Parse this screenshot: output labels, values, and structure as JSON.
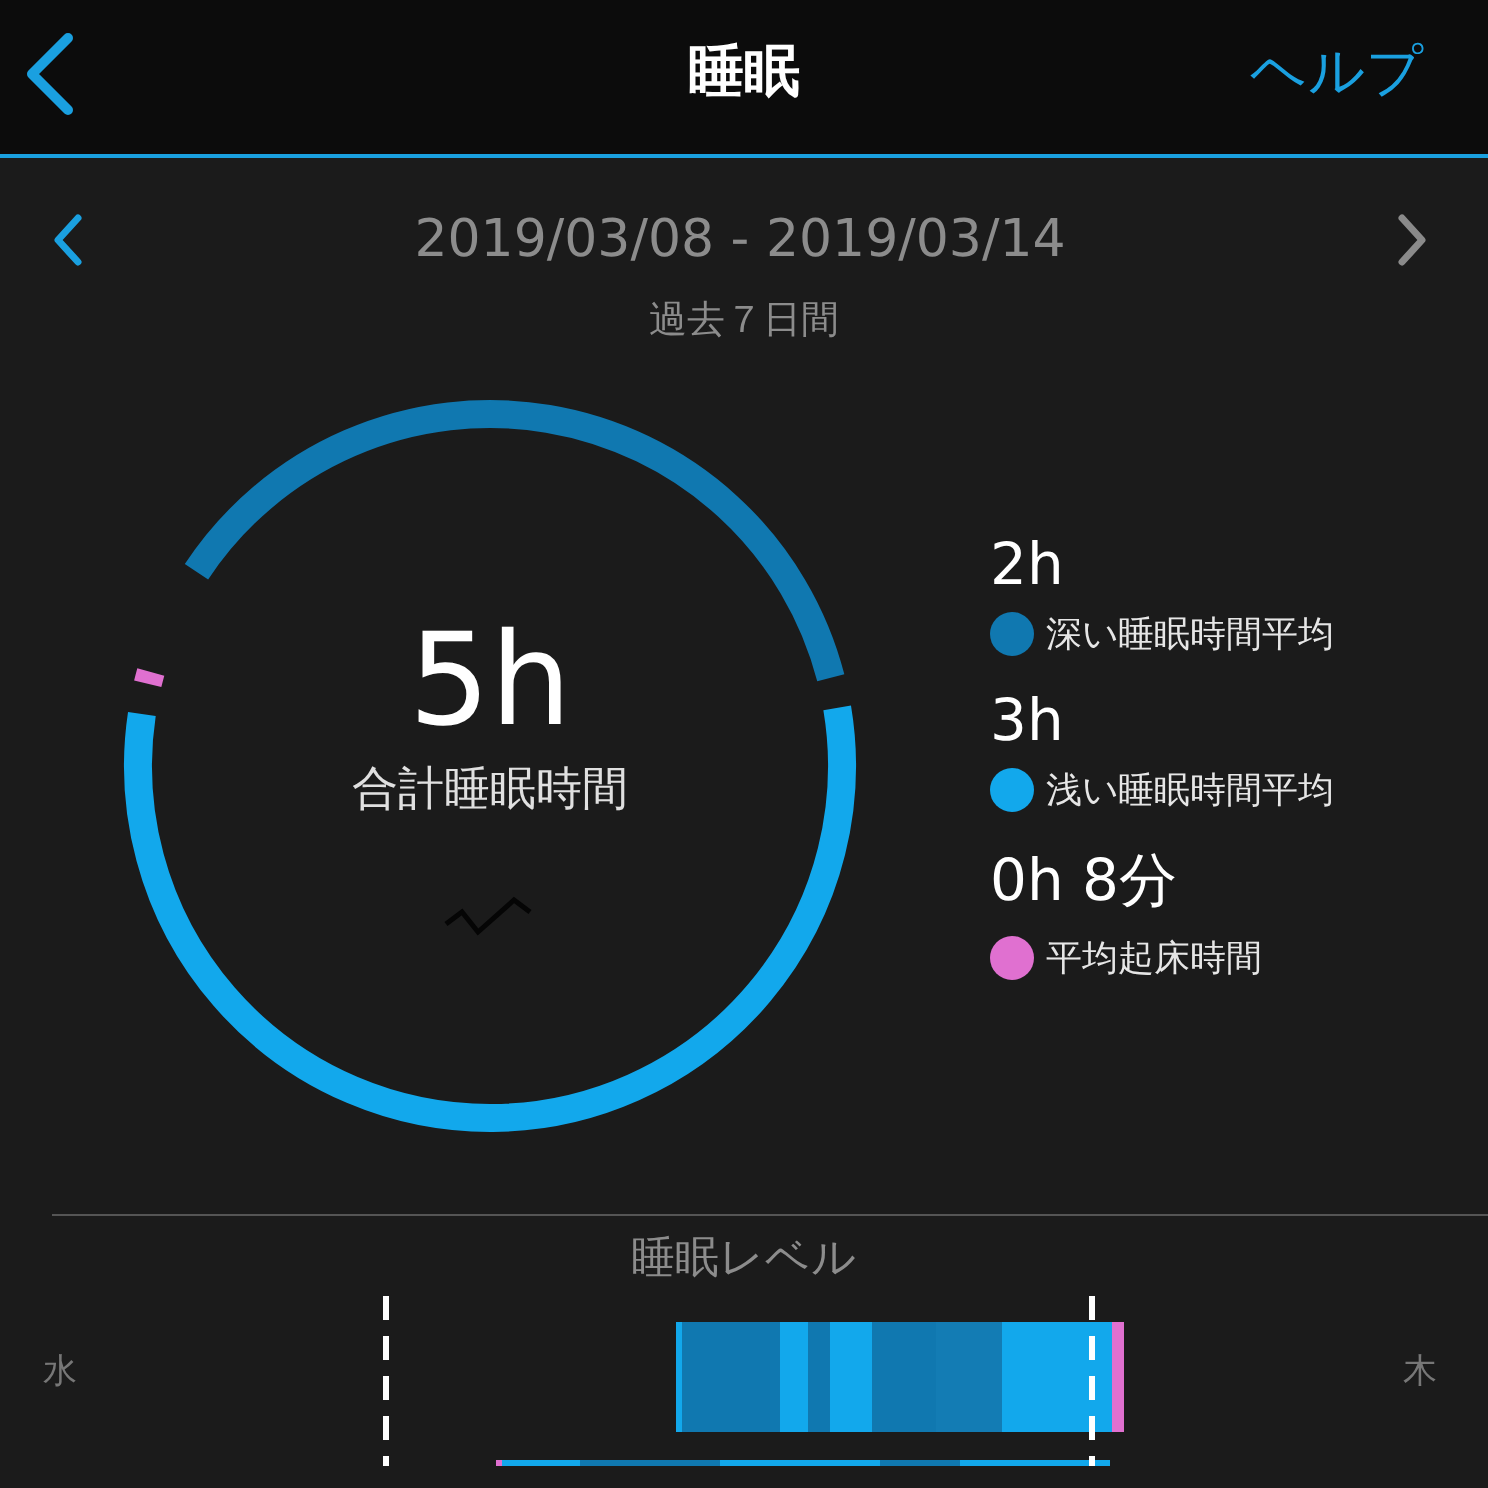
{
  "header": {
    "title": "睡眠",
    "help": "ヘルプ"
  },
  "period": {
    "range": "2019/03/08 - 2019/03/14",
    "subtitle": "過去７日間"
  },
  "summary": {
    "total": "5h",
    "total_label": "合計睡眠時間"
  },
  "legend": [
    {
      "value": "2h",
      "label": "深い睡眠時間平均",
      "color": "#1078b0"
    },
    {
      "value": "3h",
      "label": "浅い睡眠時間平均",
      "color": "#12a8ec"
    },
    {
      "value": "0h 8分",
      "label": "平均起床時間",
      "color": "#e070d0"
    }
  ],
  "sleep_levels": {
    "title": "睡眠レベル",
    "start_day": "水",
    "end_day": "木"
  }
}
